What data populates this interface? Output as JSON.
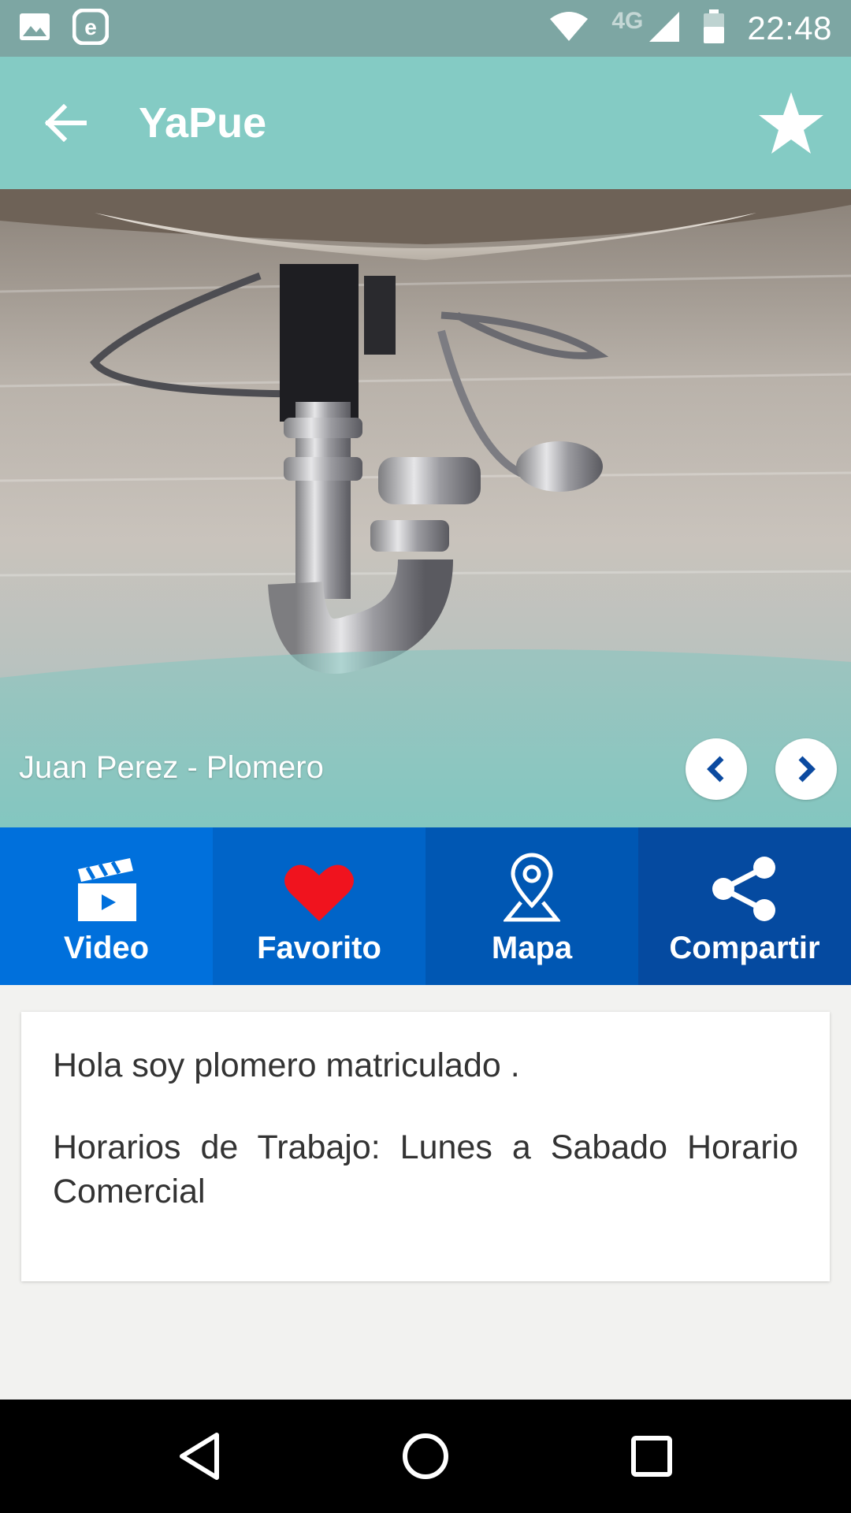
{
  "status_bar": {
    "time": "22:48",
    "network": "4G"
  },
  "app_bar": {
    "title": "YaPue"
  },
  "hero": {
    "caption": "Juan Perez - Plomero"
  },
  "actions": [
    {
      "label": "Video",
      "icon": "video-clapper-icon"
    },
    {
      "label": "Favorito",
      "icon": "heart-icon"
    },
    {
      "label": "Mapa",
      "icon": "map-pin-icon"
    },
    {
      "label": "Compartir",
      "icon": "share-icon"
    }
  ],
  "card": {
    "intro": "Hola soy plomero matriculado .",
    "schedule": "Horarios de Trabajo: Lunes a Sabado Horario Comercial"
  },
  "colors": {
    "status_bar": "#7da6a3",
    "app_bar": "#84cbc4",
    "heart": "#f0131e",
    "action_blues": [
      "#0070dc",
      "#0064c8",
      "#0057b3",
      "#054aa0"
    ]
  }
}
